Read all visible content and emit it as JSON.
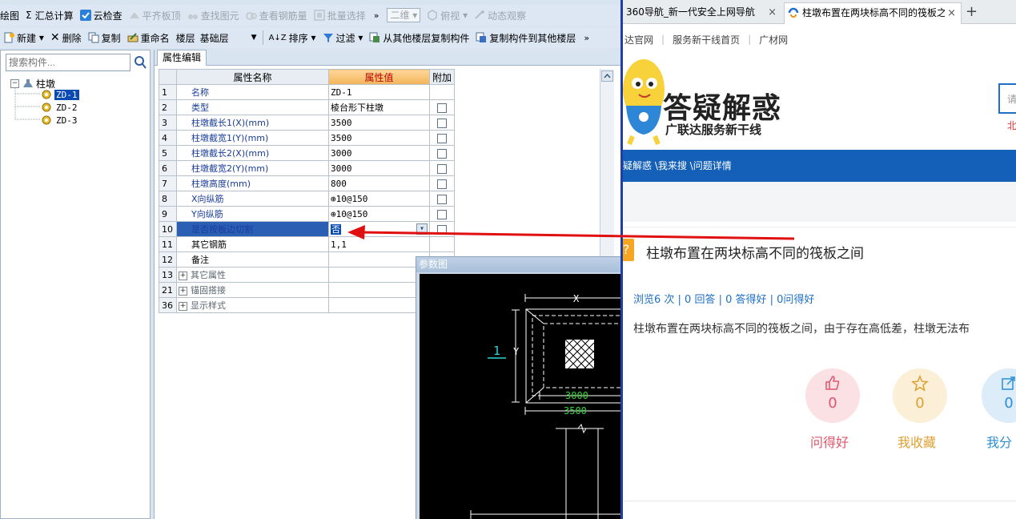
{
  "toolbar1": {
    "items": [
      {
        "label": "绘图",
        "enabled": true
      },
      {
        "label": "汇总计算",
        "enabled": true
      },
      {
        "label": "云检查",
        "enabled": true
      },
      {
        "label": "平齐板顶",
        "enabled": false
      },
      {
        "label": "查找图元",
        "enabled": false
      },
      {
        "label": "查看钢筋量",
        "enabled": false
      },
      {
        "label": "批量选择",
        "enabled": false
      },
      {
        "label": "二维",
        "enabled": false
      },
      {
        "label": "俯视",
        "enabled": false
      },
      {
        "label": "动态观察",
        "enabled": false
      }
    ],
    "overflow": "»",
    "sigma": "Σ"
  },
  "toolbar2": {
    "new_label": "新建",
    "delete_label": "删除",
    "copy_label": "复制",
    "rename_label": "重命名",
    "floor_label": "楼层",
    "floor_value": "基础层",
    "sort_label": "排序",
    "filter_label": "过滤",
    "copy_from_label": "从其他楼层复制构件",
    "copy_to_label": "复制构件到其他楼层",
    "overflow": "»"
  },
  "tree": {
    "search_placeholder": "搜索构件...",
    "root_label": "柱墩",
    "items": [
      "ZD-1",
      "ZD-2",
      "ZD-3"
    ],
    "selected": "ZD-1"
  },
  "property_tab": "属性编辑",
  "grid": {
    "headers": {
      "name": "属性名称",
      "value": "属性值",
      "attach": "附加"
    },
    "rows": [
      {
        "num": "1",
        "name": "名称",
        "value": "ZD-1",
        "attach": false
      },
      {
        "num": "2",
        "name": "类型",
        "value": "棱台形下柱墩",
        "attach": true
      },
      {
        "num": "3",
        "name": "柱墩截长1(X)(mm)",
        "value": "3500",
        "attach": true
      },
      {
        "num": "4",
        "name": "柱墩截宽1(Y)(mm)",
        "value": "3500",
        "attach": true
      },
      {
        "num": "5",
        "name": "柱墩截长2(X)(mm)",
        "value": "3000",
        "attach": true
      },
      {
        "num": "6",
        "name": "柱墩截宽2(Y)(mm)",
        "value": "3000",
        "attach": true
      },
      {
        "num": "7",
        "name": "柱墩高度(mm)",
        "value": "800",
        "attach": true
      },
      {
        "num": "8",
        "name": "X向纵筋",
        "value": "⊕10@150",
        "attach": true
      },
      {
        "num": "9",
        "name": "Y向纵筋",
        "value": "⊕10@150",
        "attach": true
      },
      {
        "num": "10",
        "name": "是否按板边切割",
        "value": "否",
        "attach": true
      },
      {
        "num": "11",
        "name": "其它钢筋",
        "value": "1,1",
        "attach": false
      },
      {
        "num": "12",
        "name": "备注",
        "value": "",
        "attach": false
      },
      {
        "num": "13",
        "name": "其它属性",
        "value": "",
        "attach": false
      },
      {
        "num": "21",
        "name": "锚固搭接",
        "value": "",
        "attach": false
      },
      {
        "num": "36",
        "name": "显示样式",
        "value": "",
        "attach": false
      }
    ],
    "selected_row": "10",
    "group_expander": "+"
  },
  "param_window": {
    "title": "参数图",
    "labels": {
      "x": "X",
      "y": "Y",
      "one": "1",
      "dim1": "3000",
      "dim2": "3500"
    }
  },
  "browser": {
    "tabs": [
      {
        "label": "360导航_新一代安全上网导航",
        "active": false
      },
      {
        "label": "柱墩布置在两块标高不同的筏板之间",
        "active": true
      }
    ],
    "new_tab": "+",
    "close_glyph": "×",
    "top_links": [
      "达官网",
      "服务新干线首页",
      "广材网"
    ],
    "logo_title": "答疑解惑",
    "logo_subtitle": "广联达服务新干线",
    "search_hint": "请",
    "region": "北",
    "breadcrumb": "疑解惑 \\我来搜 \\问题详情",
    "question_title": "柱墩布置在两块标高不同的筏板之间",
    "question_badge": "?",
    "stats": "浏览6 次 | 0 回答 | 0 答得好 | 0问得好",
    "description": "柱墩布置在两块标高不同的筏板之间，由于存在高低差，柱墩无法布",
    "actions": [
      {
        "label": "问得好",
        "count": "0",
        "color": "#e0566b",
        "bg": "#fbe0e4"
      },
      {
        "label": "我收藏",
        "count": "0",
        "color": "#e0a030",
        "bg": "#fcefd8"
      },
      {
        "label": "我分",
        "count": "0",
        "color": "#2c8fd6",
        "bg": "#dcecf8"
      }
    ]
  },
  "colors": {
    "app_bg": "#d9e4f1",
    "selection": "#0a4bb3",
    "header_value": "#f3b45a",
    "annotation_arrow": "#e01010",
    "browser_bar": "#1460b8"
  }
}
